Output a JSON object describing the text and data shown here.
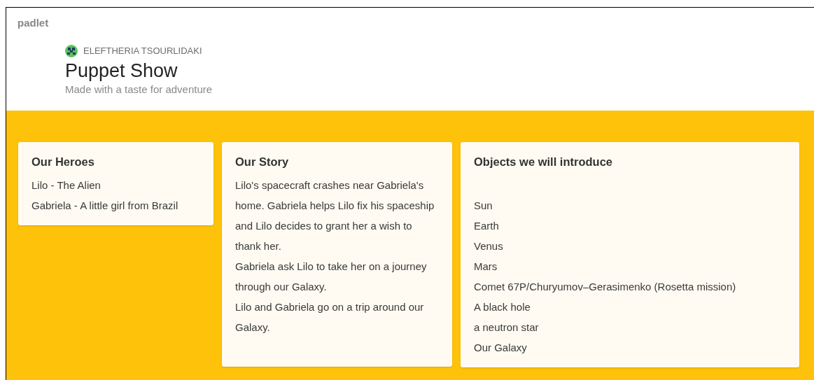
{
  "brand": "padlet",
  "author": "ELEFTHERIA TSOURLIDAKI",
  "title": "Puppet Show",
  "subtitle": "Made with a taste for adventure",
  "posts": [
    {
      "title": "Our Heroes",
      "lines": [
        "Lilo -  The Alien",
        "Gabriela - A little girl from Brazil"
      ]
    },
    {
      "title": "Our Story",
      "lines": [
        "Lilo's spacecraft crashes near Gabriela's home. Gabriela helps Lilo fix his spaceship and Lilo decides to grant her a wish to thank her.",
        "Gabriela ask Lilo to take her on a journey through our Galaxy.",
        "Lilo and Gabriela go on a trip around our Galaxy."
      ]
    },
    {
      "title": "Objects we will introduce",
      "lines": [
        "Sun",
        "Earth",
        "Venus",
        "Mars",
        "Comet 67P/Churyumov–Gerasimenko (Rosetta mission)",
        "A black hole",
        "a neutron star",
        "Our Galaxy"
      ]
    }
  ]
}
